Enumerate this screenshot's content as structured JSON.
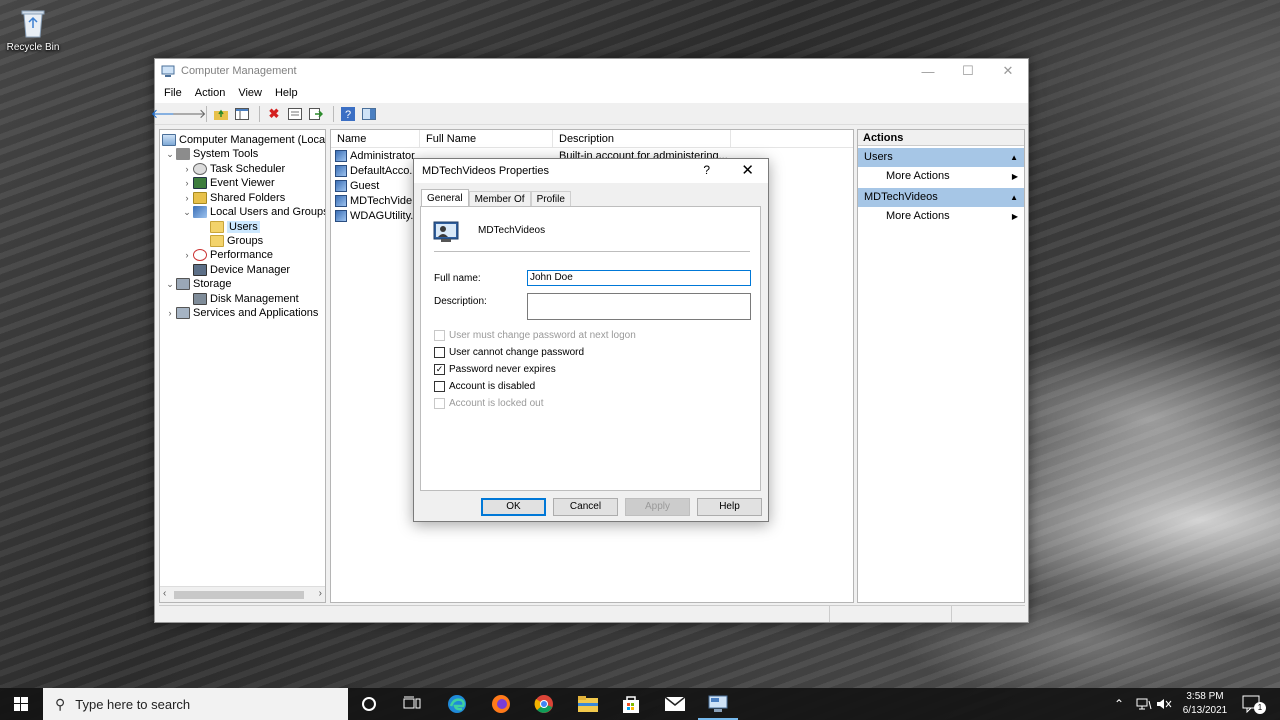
{
  "desktop": {
    "recycle_label": "Recycle Bin"
  },
  "window": {
    "title": "Computer Management",
    "menu": [
      "File",
      "Action",
      "View",
      "Help"
    ]
  },
  "tree": {
    "root": "Computer Management (Local",
    "system_tools": "System Tools",
    "task_scheduler": "Task Scheduler",
    "event_viewer": "Event Viewer",
    "shared_folders": "Shared Folders",
    "local_users_groups": "Local Users and Groups",
    "users": "Users",
    "groups": "Groups",
    "performance": "Performance",
    "device_manager": "Device Manager",
    "storage": "Storage",
    "disk_management": "Disk Management",
    "services_apps": "Services and Applications"
  },
  "list": {
    "columns": [
      "Name",
      "Full Name",
      "Description"
    ],
    "rows": [
      {
        "name": "Administrator",
        "full_name": "",
        "description": "Built-in account for administering..."
      },
      {
        "name": "DefaultAcco...",
        "full_name": "",
        "description": ""
      },
      {
        "name": "Guest",
        "full_name": "",
        "description": ""
      },
      {
        "name": "MDTechVide...",
        "full_name": "",
        "description": ""
      },
      {
        "name": "WDAGUtility...",
        "full_name": "",
        "description": ""
      }
    ]
  },
  "actions": {
    "header": "Actions",
    "section1": "Users",
    "section1_item": "More Actions",
    "section2": "MDTechVideos",
    "section2_item": "More Actions"
  },
  "dialog": {
    "title": "MDTechVideos Properties",
    "help_glyph": "?",
    "close_glyph": "✕",
    "tabs": [
      "General",
      "Member Of",
      "Profile"
    ],
    "username": "MDTechVideos",
    "full_name_label": "Full name:",
    "full_name_value": "John Doe",
    "description_label": "Description:",
    "description_value": "",
    "checkboxes": [
      {
        "label": "User must change password at next logon",
        "checked": false,
        "enabled": false
      },
      {
        "label": "User cannot change password",
        "checked": false,
        "enabled": true
      },
      {
        "label": "Password never expires",
        "checked": true,
        "enabled": true
      },
      {
        "label": "Account is disabled",
        "checked": false,
        "enabled": true
      },
      {
        "label": "Account is locked out",
        "checked": false,
        "enabled": false
      }
    ],
    "buttons": {
      "ok": "OK",
      "cancel": "Cancel",
      "apply": "Apply",
      "help": "Help"
    }
  },
  "taskbar": {
    "search_placeholder": "Type here to search",
    "time": "3:58 PM",
    "date": "6/13/2021",
    "notification_count": "1"
  },
  "colors": {
    "accent": "#0078d7",
    "selection": "#cce8ff",
    "actions_section": "#a6c6e6",
    "taskbar": "#141414"
  }
}
